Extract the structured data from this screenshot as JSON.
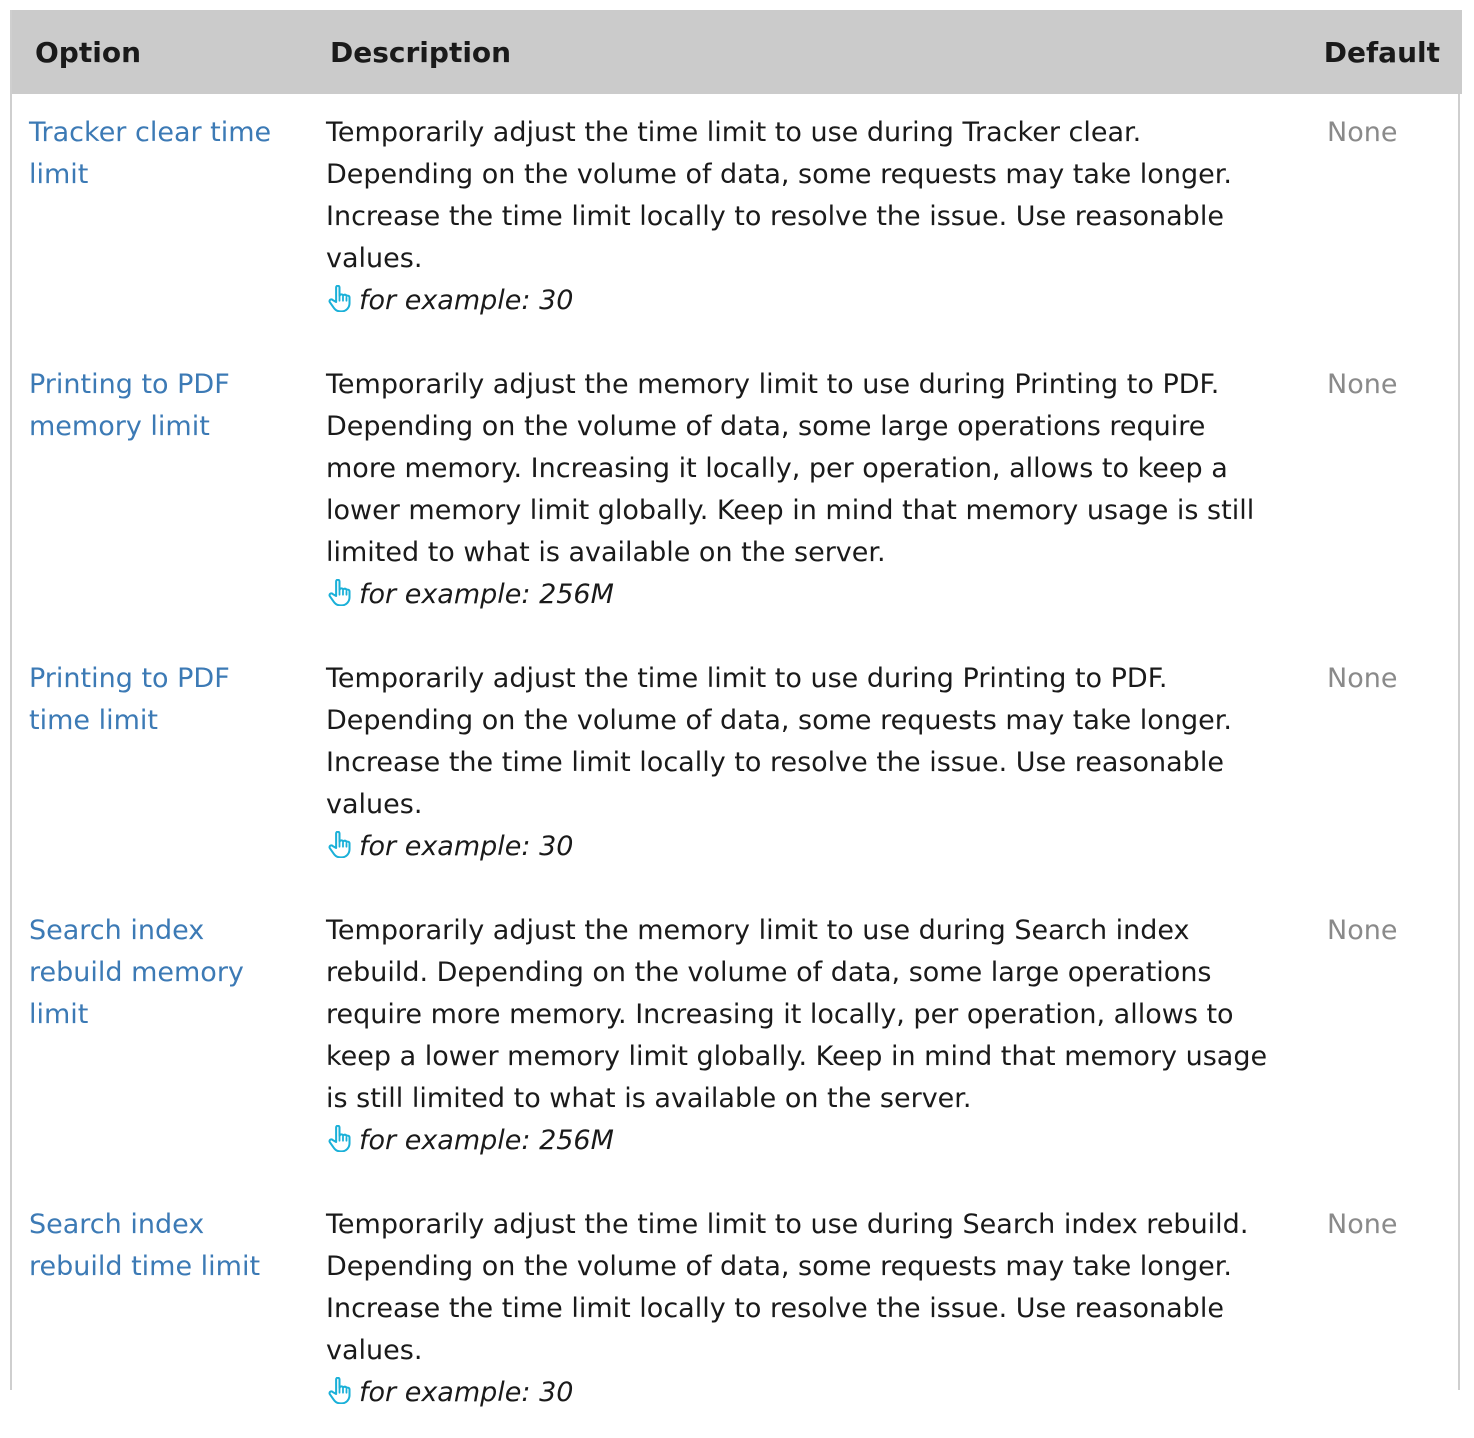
{
  "table": {
    "headers": {
      "option": "Option",
      "description": "Description",
      "default": "Default"
    },
    "rows": [
      {
        "option": "Tracker clear time limit",
        "description": "Temporarily adjust the time limit to use during Tracker clear. Depending on the volume of data, some requests may take longer. Increase the time limit locally to resolve the issue. Use reasonable values.",
        "example": "for example: 30",
        "default": "None"
      },
      {
        "option": "Printing to PDF memory limit",
        "description": "Temporarily adjust the memory limit to use during Printing to PDF. Depending on the volume of data, some large operations require more memory. Increasing it locally, per operation, allows to keep a lower memory limit globally. Keep in mind that memory usage is still limited to what is available on the server.",
        "example": "for example: 256M",
        "default": "None"
      },
      {
        "option": "Printing to PDF time limit",
        "description": "Temporarily adjust the time limit to use during Printing to PDF. Depending on the volume of data, some requests may take longer. Increase the time limit locally to resolve the issue. Use reasonable values.",
        "example": "for example: 30",
        "default": "None"
      },
      {
        "option": "Search index rebuild memory limit",
        "description": "Temporarily adjust the memory limit to use during Search index rebuild. Depending on the volume of data, some large operations require more memory. Increasing it locally, per operation, allows to keep a lower memory limit globally. Keep in mind that memory usage is still limited to what is available on the server.",
        "example": "for example: 256M",
        "default": "None"
      },
      {
        "option": "Search index rebuild time limit",
        "description": "Temporarily adjust the time limit to use during Search index rebuild. Depending on the volume of data, some requests may take longer. Increase the time limit locally to resolve the issue. Use reasonable values.",
        "example": "for example: 30",
        "default": "None"
      }
    ]
  },
  "icons": {
    "example": "pointing-hand-icon"
  },
  "colors": {
    "header_bg": "#cbcbcb",
    "link": "#3c7ab5",
    "default_text": "#8a8a8a",
    "icon": "#1ab0d8"
  }
}
